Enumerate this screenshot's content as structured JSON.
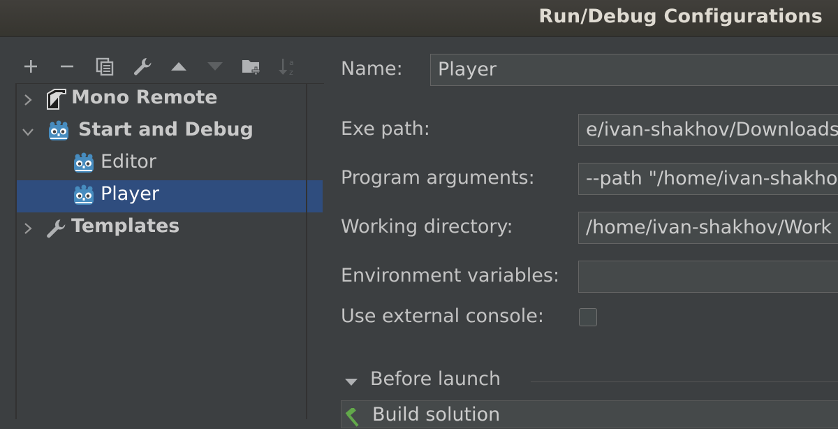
{
  "window": {
    "title": "Run/Debug Configurations"
  },
  "toolbar": {
    "buttons": [
      {
        "icon": "add-icon",
        "label": "+"
      },
      {
        "icon": "remove-icon",
        "label": "−"
      },
      {
        "icon": "copy-icon"
      },
      {
        "icon": "wrench-icon"
      },
      {
        "icon": "move-up-icon"
      },
      {
        "icon": "move-down-icon"
      },
      {
        "icon": "new-folder-icon"
      },
      {
        "icon": "sort-alpha-icon"
      }
    ]
  },
  "tree": {
    "items": [
      {
        "label": "Mono Remote",
        "icon": "mono-remote-icon",
        "expanded": false,
        "level": 0,
        "bold": true
      },
      {
        "label": "Start and Debug",
        "icon": "godot-icon",
        "expanded": true,
        "level": 0,
        "bold": true
      },
      {
        "label": "Editor",
        "icon": "godot-icon",
        "level": 1,
        "bold": false
      },
      {
        "label": "Player",
        "icon": "godot-icon",
        "level": 1,
        "bold": false,
        "selected": true
      },
      {
        "label": "Templates",
        "icon": "wrench-icon",
        "expanded": false,
        "level": 0,
        "bold": true
      }
    ]
  },
  "form": {
    "name_label": "Name:",
    "name_value": "Player",
    "exe_path_label": "Exe path:",
    "exe_path_value": "e/ivan-shakhov/Downloads",
    "program_args_label": "Program arguments:",
    "program_args_value": "--path \"/home/ivan-shakho",
    "working_dir_label": "Working directory:",
    "working_dir_value": "/home/ivan-shakhov/Work",
    "env_vars_label": "Environment variables:",
    "env_vars_value": "",
    "external_console_label": "Use external console:",
    "external_console_checked": false
  },
  "before_launch": {
    "title": "Before launch",
    "tasks": [
      {
        "label": "Build solution",
        "icon": "hammer-icon"
      }
    ]
  },
  "colors": {
    "background": "#3c3f41",
    "selection": "#2f4d7e",
    "field": "#45494a",
    "godot_blue": "#478cbf"
  }
}
